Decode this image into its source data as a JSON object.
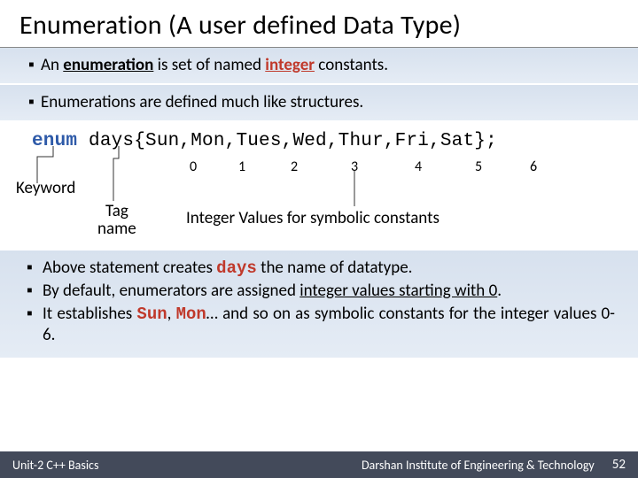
{
  "title": "Enumeration (A user defined Data Type)",
  "bullets_top": [
    {
      "pre": "An ",
      "b1": "enumeration",
      "mid": " is set of named ",
      "b2": "integer",
      "post": " constants."
    },
    {
      "plain": "Enumerations are defined much like structures."
    }
  ],
  "code": {
    "kw": "enum",
    "rest": " days{Sun,Mon,Tues,Wed,Thur,Fri,Sat};"
  },
  "numbers": [
    "0",
    "1",
    "2",
    "3",
    "4",
    "5",
    "6"
  ],
  "labels": {
    "keyword": "Keyword",
    "tag1": "Tag",
    "tag2": "name",
    "integer_vals": "Integer Values for symbolic constants"
  },
  "bullets_bottom": {
    "l1a": "Above statement creates ",
    "l1b": "days",
    "l1c": " the name of datatype.",
    "l2a": "By default, enumerators are assigned ",
    "l2b": "integer values starting with 0",
    "l2c": ".",
    "l3a": "It establishes ",
    "l3b": "Sun",
    "l3c": ", ",
    "l3d": "Mon",
    "l3e": "… and so on as symbolic constants for the integer values 0-6."
  },
  "footer": {
    "left": "Unit-2 C++ Basics",
    "center": "Darshan Institute of Engineering & Technology",
    "right": "52"
  }
}
